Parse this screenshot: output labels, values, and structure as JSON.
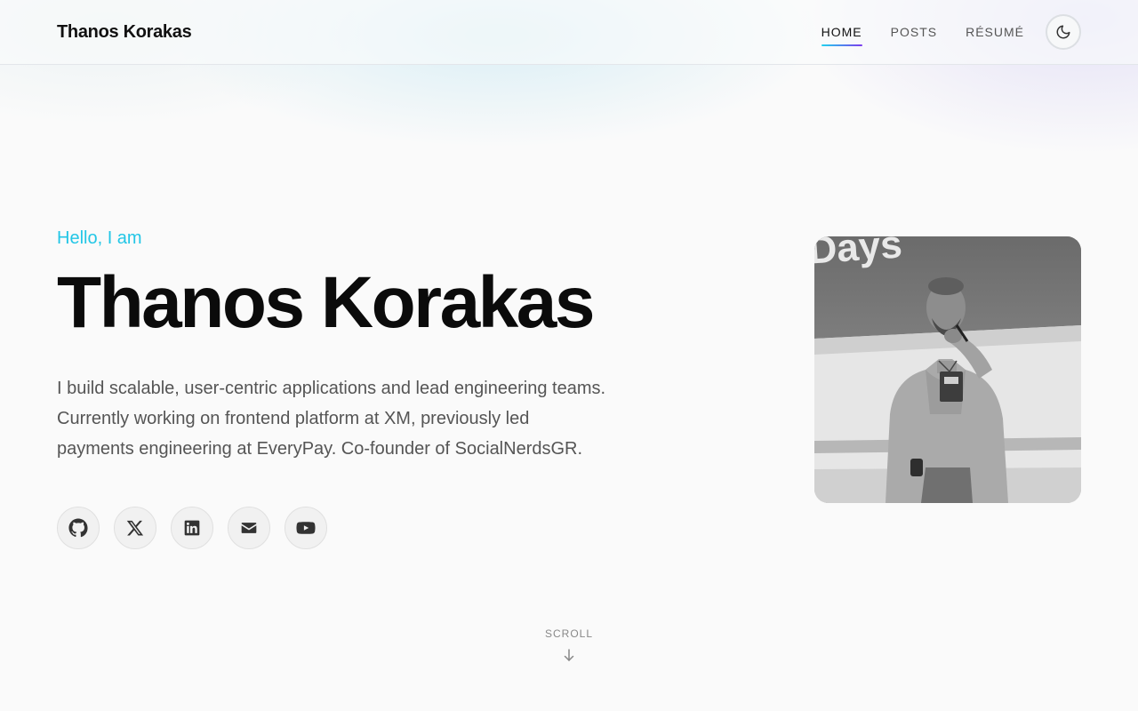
{
  "header": {
    "brand": "Thanos Korakas",
    "nav": [
      {
        "label": "HOME",
        "active": true
      },
      {
        "label": "POSTS",
        "active": false
      },
      {
        "label": "RÉSUMÉ",
        "active": false
      }
    ],
    "theme_toggle_icon": "moon-icon"
  },
  "hero": {
    "greeting": "Hello, I am",
    "name": "Thanos Korakas",
    "bio": "I build scalable, user-centric applications and lead engineering teams. Currently working on frontend platform at XM, previously led payments engineering at EveryPay. Co-founder of SocialNerdsGR.",
    "socials": [
      {
        "icon": "github-icon"
      },
      {
        "icon": "x-icon"
      },
      {
        "icon": "linkedin-icon"
      },
      {
        "icon": "email-icon"
      },
      {
        "icon": "youtube-icon"
      }
    ],
    "photo_text": "Days"
  },
  "scroll": {
    "label": "SCROLL",
    "icon": "arrow-down-icon"
  },
  "colors": {
    "accent": "#22c6e6",
    "accent_gradient_end": "#7c3aed",
    "text": "#111111",
    "muted": "#555555"
  }
}
